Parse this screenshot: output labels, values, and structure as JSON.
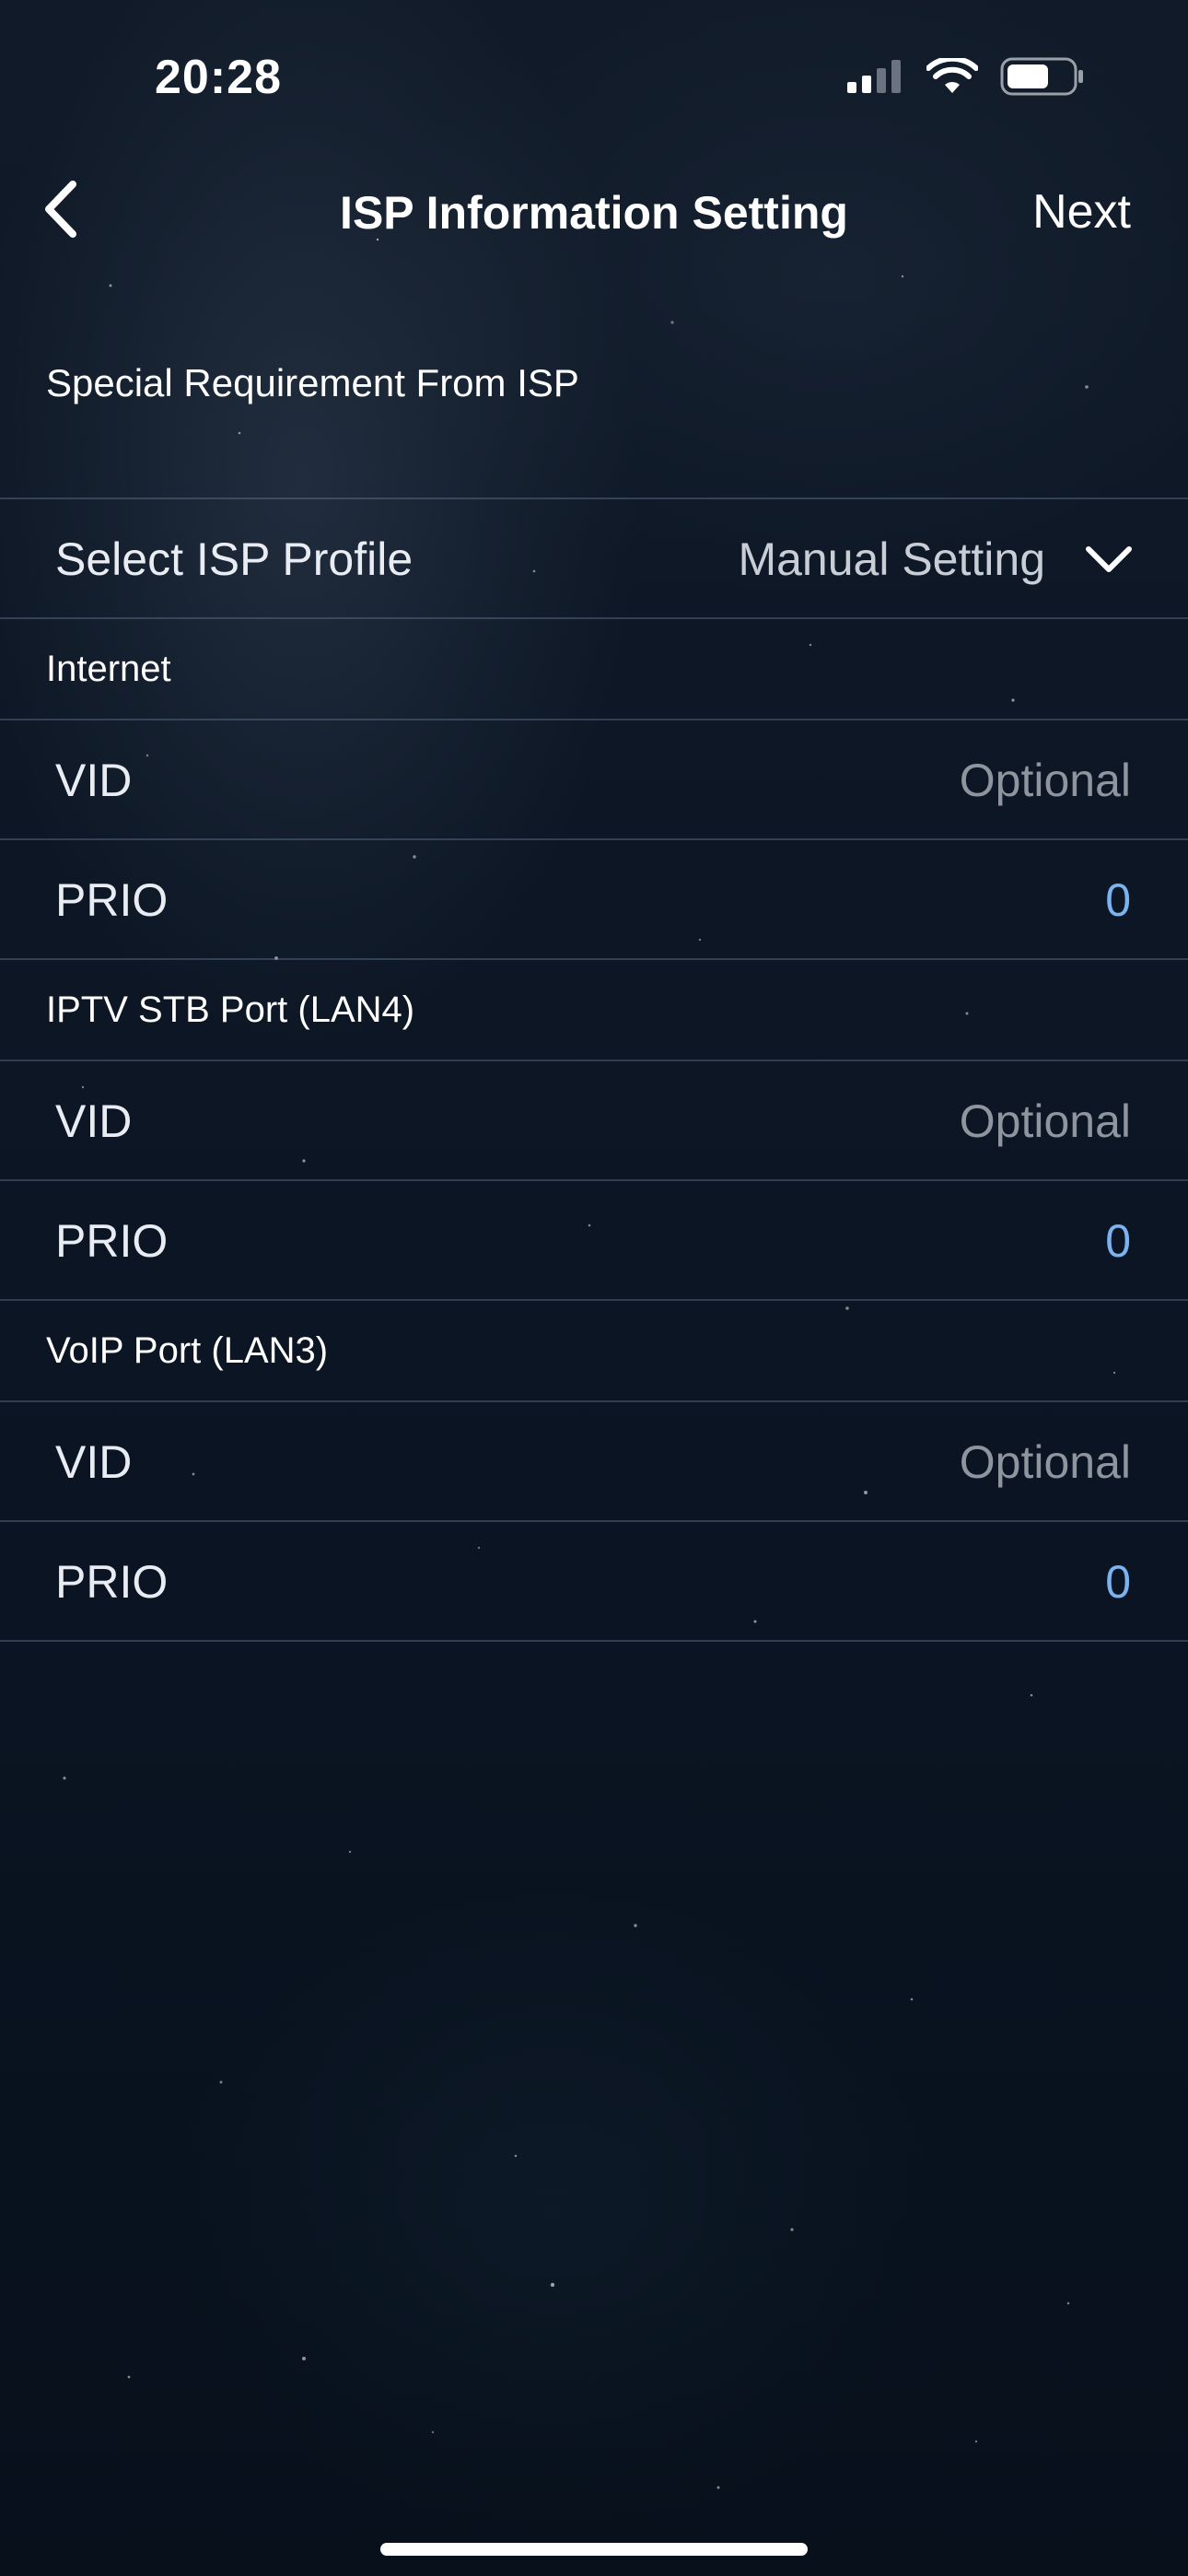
{
  "status_bar": {
    "time": "20:28",
    "icons": [
      "cellular-signal-icon",
      "wifi-icon",
      "battery-icon"
    ]
  },
  "nav": {
    "back_icon": "chevron-left-icon",
    "title": "ISP Information Setting",
    "next_label": "Next"
  },
  "section_title": "Special Requirement From ISP",
  "isp_profile": {
    "label": "Select ISP Profile",
    "value": "Manual Setting",
    "icon": "chevron-down-icon"
  },
  "groups": {
    "internet": {
      "title": "Internet",
      "vid_label": "VID",
      "vid_placeholder": "Optional",
      "prio_label": "PRIO",
      "prio_value": "0"
    },
    "iptv": {
      "title": "IPTV STB Port (LAN4)",
      "vid_label": "VID",
      "vid_placeholder": "Optional",
      "prio_label": "PRIO",
      "prio_value": "0"
    },
    "voip": {
      "title": "VoIP Port (LAN3)",
      "vid_label": "VID",
      "vid_placeholder": "Optional",
      "prio_label": "PRIO",
      "prio_value": "0"
    }
  },
  "colors": {
    "value_accent": "#7ab3ef",
    "placeholder": "#8e959e",
    "background": "#0c1624"
  }
}
